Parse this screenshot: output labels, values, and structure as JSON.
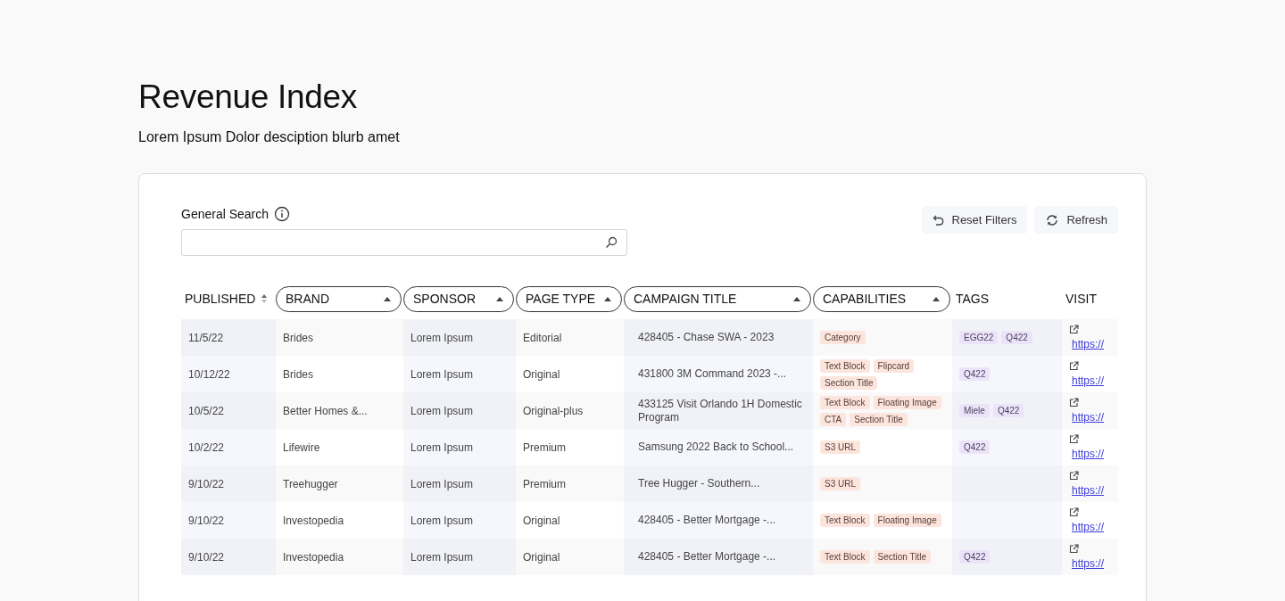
{
  "page": {
    "title": "Revenue Index",
    "description": "Lorem Ipsum Dolor desciption blurb amet"
  },
  "search": {
    "label": "General Search"
  },
  "actions": [
    {
      "label": "Reset Filters",
      "kind": "reset"
    },
    {
      "label": "Refresh",
      "kind": "refresh"
    }
  ],
  "table": {
    "columns": [
      {
        "label": "PUBLISHED",
        "kind": "sort"
      },
      {
        "label": "BRAND",
        "kind": "filter"
      },
      {
        "label": "SPONSOR",
        "kind": "filter"
      },
      {
        "label": "PAGE TYPE",
        "kind": "filter"
      },
      {
        "label": "CAMPAIGN TITLE",
        "kind": "filter"
      },
      {
        "label": "CAPABILITIES",
        "kind": "filter"
      },
      {
        "label": "TAGS",
        "kind": "plain"
      },
      {
        "label": "VISIT",
        "kind": "plain"
      }
    ],
    "rows": [
      {
        "published": "11/5/22",
        "brand": "Brides",
        "sponsor": "Lorem Ipsum",
        "page_type": "Editorial",
        "campaign": "428405 - Chase SWA - 2023",
        "capabilities": [
          "Category"
        ],
        "tags": [
          "EGG22",
          "Q422"
        ],
        "visit": "https://"
      },
      {
        "published": "10/12/22",
        "brand": "Brides",
        "sponsor": "Lorem Ipsum",
        "page_type": "Original",
        "campaign": "431800 3M Command 2023 -...",
        "capabilities": [
          "Text Block",
          "Flipcard",
          "Section Title"
        ],
        "tags": [
          "Q422"
        ],
        "visit": "https://"
      },
      {
        "published": "10/5/22",
        "brand": "Better Homes &...",
        "sponsor": "Lorem Ipsum",
        "page_type": "Original-plus",
        "campaign": "433125 Visit Orlando 1H Domestic Program",
        "capabilities": [
          "Text Block",
          "Floating Image",
          "CTA",
          "Section Title"
        ],
        "tags": [
          "Miele",
          "Q422"
        ],
        "visit": "https://"
      },
      {
        "published": "10/2/22",
        "brand": "Lifewire",
        "sponsor": "Lorem Ipsum",
        "page_type": "Premium",
        "campaign": "Samsung 2022 Back to School...",
        "capabilities": [
          "S3 URL"
        ],
        "tags": [
          "Q422"
        ],
        "visit": "https://"
      },
      {
        "published": "9/10/22",
        "brand": "Treehugger",
        "sponsor": "Lorem Ipsum",
        "page_type": "Premium",
        "campaign": "Tree Hugger - Southern...",
        "capabilities": [
          "S3 URL"
        ],
        "tags": [],
        "visit": "https://"
      },
      {
        "published": "9/10/22",
        "brand": "Investopedia",
        "sponsor": "Lorem Ipsum",
        "page_type": "Original",
        "campaign": "428405 - Better Mortgage -...",
        "capabilities": [
          "Text Block",
          "Floating Image"
        ],
        "tags": [],
        "visit": "https://"
      },
      {
        "published": "9/10/22",
        "brand": "Investopedia",
        "sponsor": "Lorem Ipsum",
        "page_type": "Original",
        "campaign": "428405 - Better Mortgage -...",
        "capabilities": [
          "Text Block",
          "Section Title"
        ],
        "tags": [
          "Q422"
        ],
        "visit": "https://"
      }
    ]
  }
}
